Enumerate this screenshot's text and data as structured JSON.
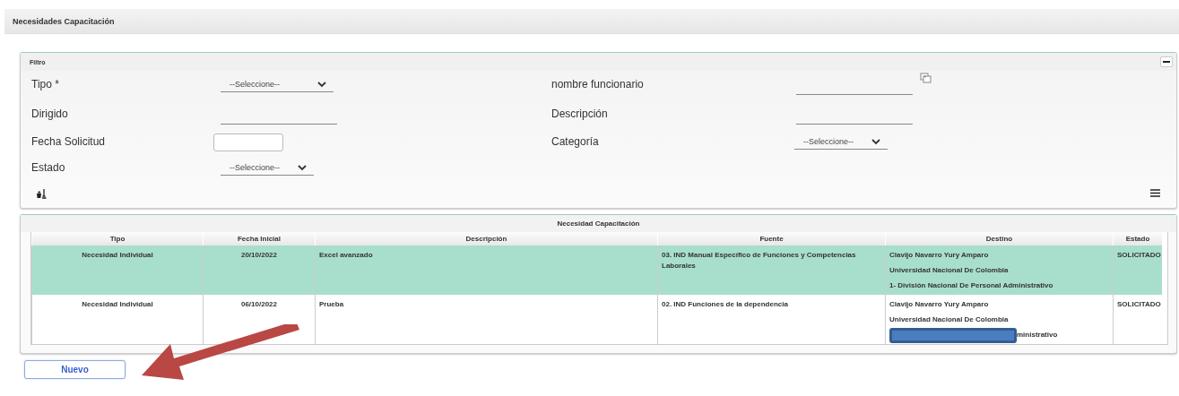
{
  "page": {
    "title": "Necesidades Capacitación"
  },
  "filter": {
    "title": "Filtro",
    "left_fields": [
      {
        "label": "Tipo *",
        "kind": "select",
        "value": "--Seleccione--"
      },
      {
        "label": "Dirigido",
        "kind": "text"
      },
      {
        "label": "Fecha Solicitud",
        "kind": "date"
      },
      {
        "label": "Estado",
        "kind": "select",
        "value": "--Seleccione--"
      }
    ],
    "right_fields": [
      {
        "label": "nombre funcionario",
        "kind": "lookup"
      },
      {
        "label": "Descripción",
        "kind": "text"
      },
      {
        "label": "Categoría",
        "kind": "select",
        "value": "--Seleccione--"
      }
    ]
  },
  "table": {
    "title": "Necesidad Capacitación",
    "columns": [
      "Tipo",
      "Fecha Inicial",
      "Descripción",
      "Fuente",
      "Destino",
      "Estado"
    ],
    "rows": [
      {
        "selected": true,
        "tipo": "Necesidad Individual",
        "fecha": "20/10/2022",
        "descripcion": "Excel avanzado",
        "fuente": "03. IND Manual Específico de Funciones y Competencias Laborales",
        "destino": [
          {
            "text": "Clavijo Navarro Yury Amparo",
            "redacted": false
          },
          {
            "text": "Universidad Nacional De Colombia",
            "redacted": false
          },
          {
            "text": "1- División Nacional De Personal Administrativo",
            "redacted": false
          }
        ],
        "estado": "SOLICITADO"
      },
      {
        "selected": false,
        "tipo": "Necesidad Individual",
        "fecha": "06/10/2022",
        "descripcion": "Prueba",
        "fuente": "02. IND Funciones de la dependencia",
        "destino": [
          {
            "text": "Clavijo Navarro Yury Amparo",
            "redacted": false
          },
          {
            "text": "Universidad Nacional De Colombia",
            "redacted": false
          },
          {
            "text": "ministrativo",
            "redacted": true
          }
        ],
        "estado": "SOLICITADO"
      }
    ]
  },
  "buttons": [
    {
      "label": "Nuevo"
    }
  ]
}
